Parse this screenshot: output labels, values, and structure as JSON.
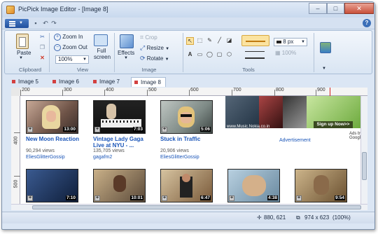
{
  "window": {
    "title": "PicPick Image Editor - [Image 8]",
    "controls": {
      "minimize": "–",
      "maximize": "□",
      "close": "✕"
    }
  },
  "ribbon": {
    "clipboard": {
      "paste": "Paste",
      "label": "Clipboard"
    },
    "view": {
      "zoom_in": "Zoom In",
      "zoom_out": "Zoom Out",
      "zoom_level": "100%",
      "full_screen_line1": "Full",
      "full_screen_line2": "screen",
      "label": "View"
    },
    "image": {
      "effects": "Effects",
      "crop": "Crop",
      "resize": "Resize",
      "rotate": "Rotate",
      "label": "Image"
    },
    "tools": {
      "label": "Tools",
      "line_width": "8 px",
      "opacity": "100%"
    }
  },
  "tabs": [
    {
      "label": "Image 5"
    },
    {
      "label": "Image 6"
    },
    {
      "label": "Image 7"
    },
    {
      "label": "Image 8",
      "active": true
    }
  ],
  "rulers": {
    "top": [
      "200",
      "300",
      "400",
      "500",
      "600",
      "700",
      "800",
      "900"
    ],
    "left": [
      "400",
      "500"
    ]
  },
  "videos": [
    {
      "title_line1": "New Moon Reaction",
      "title_line2": "",
      "views": "90,294 views",
      "user": "EliesGlitterGossip",
      "duration": "13:00"
    },
    {
      "title_line1": "Vintage Lady Gaga",
      "title_line2": "Live at NYU - ...",
      "views": "135,705 views",
      "user": "gagafm2",
      "duration": "7:03"
    },
    {
      "title_line1": "Stuck in Traffic",
      "title_line2": "",
      "views": "20,906 views",
      "user": "EliesGlitterGossip",
      "duration": "5:06"
    }
  ],
  "videos_row2": [
    {
      "duration": "7:10"
    },
    {
      "duration": "10:01"
    },
    {
      "duration": "6:47"
    },
    {
      "duration": "4:38"
    },
    {
      "duration": "9:54"
    }
  ],
  "ad": {
    "url": "www.Music.Nokia.co.in",
    "label": "Advertisement",
    "signup": "Sign up Now>>",
    "ads_by": "Ads by Google"
  },
  "status": {
    "cursor": "880, 621",
    "size": "974 x 623",
    "zoom": "(100%)"
  },
  "colors": {
    "link": "#1a55b8",
    "tab_marker": "#d24040"
  }
}
